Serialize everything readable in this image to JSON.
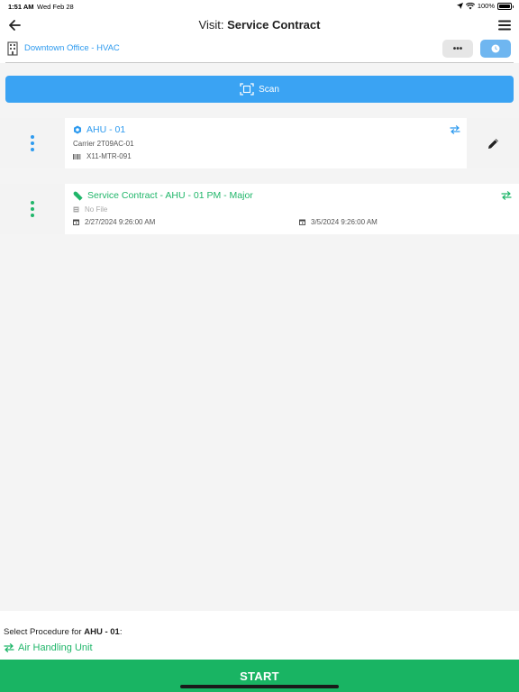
{
  "status_bar": {
    "time": "1:51 AM",
    "date": "Wed Feb 28",
    "battery": "100%"
  },
  "header": {
    "title_prefix": "Visit: ",
    "title_bold": "Service Contract",
    "back_icon": "arrow-left-icon",
    "menu_icon": "hamburger-menu-icon"
  },
  "location_bar": {
    "location": "Downtown Office - HVAC",
    "more_label": "•••",
    "clock_icon": "clock-icon"
  },
  "scan_button": {
    "label": "Scan"
  },
  "equipment_card": {
    "name": "AHU - 01",
    "model": "Carrier 2T09AC-01",
    "serial": "X11-MTR-091"
  },
  "procedure_card": {
    "name": "Service Contract - AHU - 01 PM - Major",
    "file": "No File",
    "start_date": "2/27/2024 9:26:00 AM",
    "end_date": "3/5/2024 9:26:00 AM"
  },
  "bottom": {
    "prompt_prefix": "Select Procedure for ",
    "prompt_bold": "AHU - 01",
    "prompt_suffix": ":",
    "procedure": "Air Handling Unit",
    "start_label": "START"
  },
  "colors": {
    "accent_blue": "#3aa3f3",
    "link_blue": "#2f9bef",
    "accent_green": "#19b463"
  }
}
